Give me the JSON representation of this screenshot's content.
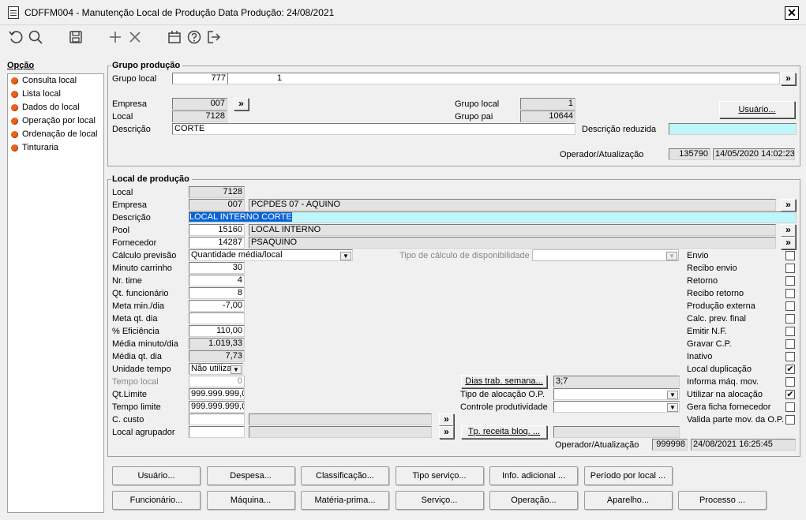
{
  "window": {
    "title": "CDFFM004 - Manutenção Local de Produção Data Produção: 24/08/2021",
    "close": "✕"
  },
  "sidebar": {
    "title": "Opção",
    "items": [
      {
        "label": "Consulta local"
      },
      {
        "label": "Lista local"
      },
      {
        "label": "Dados do local"
      },
      {
        "label": "Operação por local"
      },
      {
        "label": "Ordenação de local"
      },
      {
        "label": "Tinturaria"
      }
    ]
  },
  "grupo": {
    "title": "Grupo produção",
    "grupo_local_label": "Grupo local",
    "grupo_local_value1": "777",
    "grupo_local_value2": "1",
    "empresa_label": "Empresa",
    "empresa_value": "007",
    "local_label": "Local",
    "local_value": "7128",
    "descricao_label": "Descrição",
    "descricao_value": "CORTE",
    "grupo_local2_label": "Grupo local",
    "grupo_local2_value": "1",
    "grupo_pai_label": "Grupo pai",
    "grupo_pai_value": "10644",
    "usuario_button": "Usuário...",
    "desc_reduzida_label": "Descrição reduzida",
    "desc_reduzida_value": "",
    "operador_label": "Operador/Atualização",
    "operador_value": "135790",
    "atualizacao_value": "14/05/2020 14:02:23"
  },
  "local": {
    "title": "Local de produção",
    "local_label": "Local",
    "local_value": "7128",
    "empresa_label": "Empresa",
    "empresa_value": "007",
    "empresa_name": "PCPDES 07 - AQUINO",
    "descricao_label": "Descrição",
    "descricao_value": "LOCAL INTERNO CORTE",
    "pool_label": "Pool",
    "pool_value": "15160",
    "pool_name": "LOCAL INTERNO",
    "fornecedor_label": "Fornecedor",
    "fornecedor_value": "14287",
    "fornecedor_name": "PSAQUINO",
    "calculo_label": "Cálculo previsão",
    "calculo_value": "Quantidade média/local",
    "tipo_calculo_label": "Tipo de cálculo de disponibilidade",
    "tipo_calculo_value": "",
    "minuto_label": "Minuto carrinho",
    "minuto_value": "30",
    "nrtime_label": "Nr. time",
    "nrtime_value": "4",
    "qtfunc_label": "Qt. funcionário",
    "qtfunc_value": "8",
    "metamin_label": "Meta min./dia",
    "metamin_value": "-7,00",
    "metaqt_label": "Meta qt. dia",
    "metaqt_value": "",
    "eficiencia_label": "% Eficiência",
    "eficiencia_value": "110,00",
    "mediamin_label": "Média minuto/dia",
    "mediamin_value": "1.019,33",
    "mediaqt_label": "Média qt. dia",
    "mediaqt_value": "7,73",
    "unidade_label": "Unidade tempo",
    "unidade_value": "Não utiliza",
    "tempolocal_label": "Tempo local",
    "tempolocal_value": "0",
    "qtlimite_label": "Qt.Limite",
    "qtlimite_value": "999.999.999,0",
    "tempolimite_label": "Tempo limite",
    "tempolimite_value": "999.999.999,0",
    "ccusto_label": "C. custo",
    "ccusto_value": "",
    "agrupador_label": "Local agrupador",
    "agrupador_value": "",
    "dias_button": "Dias trab. semana...",
    "dias_value": "3;7",
    "tipo_alocacao_label": "Tipo de alocação O.P.",
    "tipo_alocacao_value": "",
    "controle_label": "Controle produtividade",
    "controle_value": "",
    "tp_receita_button": "Tp. receita bloq. ...",
    "tp_receita_value": "",
    "operador_label": "Operador/Atualização",
    "operador_value": "999998",
    "atualizacao_value": "24/08/2021 16:25:45",
    "checks": [
      {
        "label": "Envio",
        "checked": false
      },
      {
        "label": "Recibo envio",
        "checked": false
      },
      {
        "label": "Retorno",
        "checked": false
      },
      {
        "label": "Recibo retorno",
        "checked": false
      },
      {
        "label": "Produção externa",
        "checked": false
      },
      {
        "label": "Calc. prev. final",
        "checked": false
      },
      {
        "label": "Emitir N.F.",
        "checked": false
      },
      {
        "label": "Gravar C.P.",
        "checked": false
      },
      {
        "label": "Inativo",
        "checked": false
      },
      {
        "label": "Local duplicação",
        "checked": true
      },
      {
        "label": "Informa máq. mov.",
        "checked": false
      },
      {
        "label": "Utilizar na alocação",
        "checked": true
      },
      {
        "label": "Gera ficha fornecedor",
        "checked": false
      },
      {
        "label": "Valida parte mov. da O.P.",
        "checked": false
      }
    ]
  },
  "buttons_row1": [
    "Usuário...",
    "Despesa...",
    "Classificação...",
    "Tipo serviço...",
    "Info. adicional ...",
    "Período por local ..."
  ],
  "buttons_row2": [
    "Funcionário...",
    "Máquina...",
    "Matéria-prima...",
    "Serviço...",
    "Operação...",
    "Aparelho...",
    "Processo ..."
  ],
  "symbols": {
    "more": "»",
    "check": "✔",
    "drop": "▼"
  }
}
